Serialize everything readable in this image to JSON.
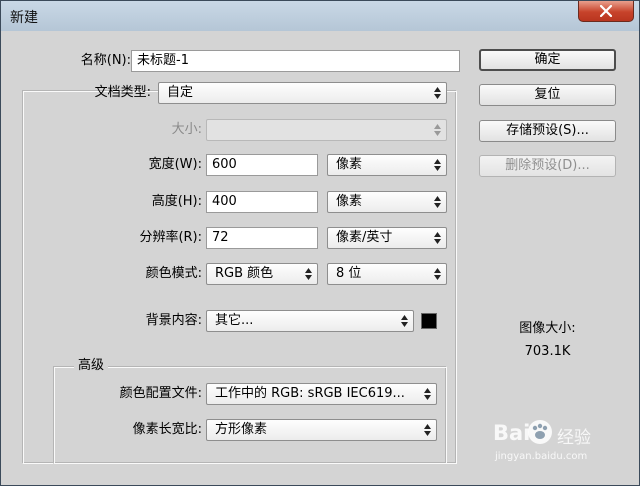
{
  "window": {
    "title": "新建"
  },
  "form": {
    "name_label": "名称(N):",
    "name_value": "未标题-1",
    "preset_label": "文档类型:",
    "preset_value": "自定",
    "size_label": "大小:",
    "size_value": "",
    "width_label": "宽度(W):",
    "width_value": "600",
    "width_unit": "像素",
    "height_label": "高度(H):",
    "height_value": "400",
    "height_unit": "像素",
    "resolution_label": "分辨率(R):",
    "resolution_value": "72",
    "resolution_unit": "像素/英寸",
    "color_mode_label": "颜色模式:",
    "color_mode_value": "RGB 颜色",
    "bit_depth_value": "8 位",
    "background_label": "背景内容:",
    "background_value": "其它...",
    "background_color": "#000000"
  },
  "advanced": {
    "legend": "高级",
    "profile_label": "颜色配置文件:",
    "profile_value": "工作中的 RGB: sRGB IEC619...",
    "aspect_label": "像素长宽比:",
    "aspect_value": "方形像素"
  },
  "buttons": {
    "ok": "确定",
    "reset": "复位",
    "save_preset": "存储预设(S)...",
    "delete_preset": "删除预设(D)..."
  },
  "image_size": {
    "label": "图像大小:",
    "value": "703.1K"
  },
  "watermark": {
    "brand_left": "Bai",
    "brand_right": "经验",
    "url": "jingyan.baidu.com"
  },
  "colors": {
    "dialog_bg": "#d4d4d4",
    "titlebar": "#bfd0df",
    "close_button": "#c7432b"
  }
}
